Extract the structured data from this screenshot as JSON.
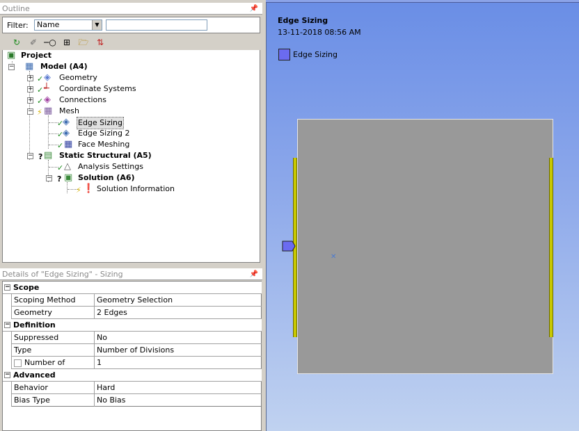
{
  "outline": {
    "title": "Outline",
    "pin": "⬍",
    "filter_label": "Filter:",
    "filter_value": "Name",
    "filter_text": ""
  },
  "toolbar": {
    "icons": [
      "refresh-icon",
      "clear-icon",
      "tree-expand-icon",
      "expand-all-icon",
      "folder-icon",
      "sort-icon"
    ]
  },
  "tree": {
    "project": "Project",
    "model": "Model (A4)",
    "geometry": "Geometry",
    "coord": "Coordinate Systems",
    "connections": "Connections",
    "mesh": "Mesh",
    "edge_sizing": "Edge Sizing",
    "edge_sizing_2": "Edge Sizing 2",
    "face_meshing": "Face Meshing",
    "static": "Static Structural (A5)",
    "analysis": "Analysis Settings",
    "solution": "Solution (A6)",
    "solution_info": "Solution Information"
  },
  "details": {
    "title": "Details of \"Edge Sizing\" - Sizing",
    "scope": {
      "label": "Scope",
      "scoping_method_k": "Scoping Method",
      "scoping_method_v": "Geometry Selection",
      "geometry_k": "Geometry",
      "geometry_v": "2 Edges"
    },
    "definition": {
      "label": "Definition",
      "suppressed_k": "Suppressed",
      "suppressed_v": "No",
      "type_k": "Type",
      "type_v": "Number of Divisions",
      "ndiv_k": "Number of Divisions",
      "ndiv_v": "1"
    },
    "advanced": {
      "label": "Advanced",
      "behavior_k": "Behavior",
      "behavior_v": "Hard",
      "bias_k": "Bias Type",
      "bias_v": "No Bias"
    }
  },
  "viewport": {
    "title": "Edge Sizing",
    "date": "13-11-2018 08:56 AM",
    "legend": "Edge Sizing",
    "legend_color": "#6b6bf0",
    "edge_color": "#c8c800",
    "plate_color": "#999999"
  }
}
